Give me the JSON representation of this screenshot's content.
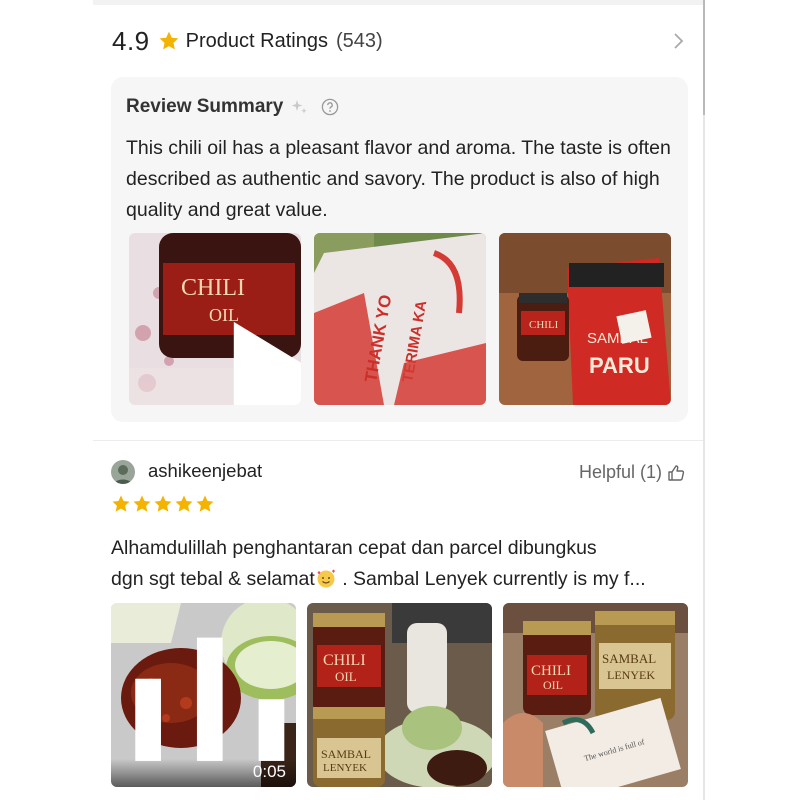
{
  "rating": {
    "score": "4.9",
    "label": "Product Ratings",
    "count": "(543)"
  },
  "summary": {
    "title": "Review Summary",
    "text": "This chili oil has a pleasant flavor and aroma. The taste is often described as authentic and savory. The product is also of high quality and great value.",
    "images": [
      {
        "type": "video",
        "alt": "Chili oil jar",
        "label": "CHILI OIL"
      },
      {
        "type": "image",
        "alt": "Parcel bag",
        "label": "THANK YOU · TERIMA KASIH"
      },
      {
        "type": "image",
        "alt": "Chili oil and Sambal Paru pack",
        "label": "SAMBAL PARU"
      }
    ]
  },
  "review": {
    "username": "ashikeenjebat",
    "helpful_label": "Helpful (1)",
    "stars": 5,
    "text_line1": "Alhamdulillah penghantaran cepat dan parcel dibungkus",
    "text_line2a": "dgn sgt tebal & selamat",
    "text_line2b": " . Sambal Lenyek currently is my f...",
    "media": [
      {
        "type": "video",
        "duration": "0:05",
        "alt": "Sambal with cucumber"
      },
      {
        "type": "image",
        "alt": "Chili oil and Sambal Lenyek jars",
        "jar1": "CHILI OIL",
        "jar2": "SAMBAL LENYEK"
      },
      {
        "type": "image",
        "alt": "Jars with thank-you card",
        "jar1": "CHILI OIL",
        "jar2": "SAMBAL LENYEK"
      }
    ]
  },
  "colors": {
    "star": "#f5b301",
    "card_bg": "#f6f6f6",
    "divider": "#ececec"
  },
  "icons": [
    "star-icon",
    "chevron-right-icon",
    "sparkle-icon",
    "help-circle-icon",
    "play-icon",
    "thumb-up-icon",
    "audio-bars-icon"
  ]
}
